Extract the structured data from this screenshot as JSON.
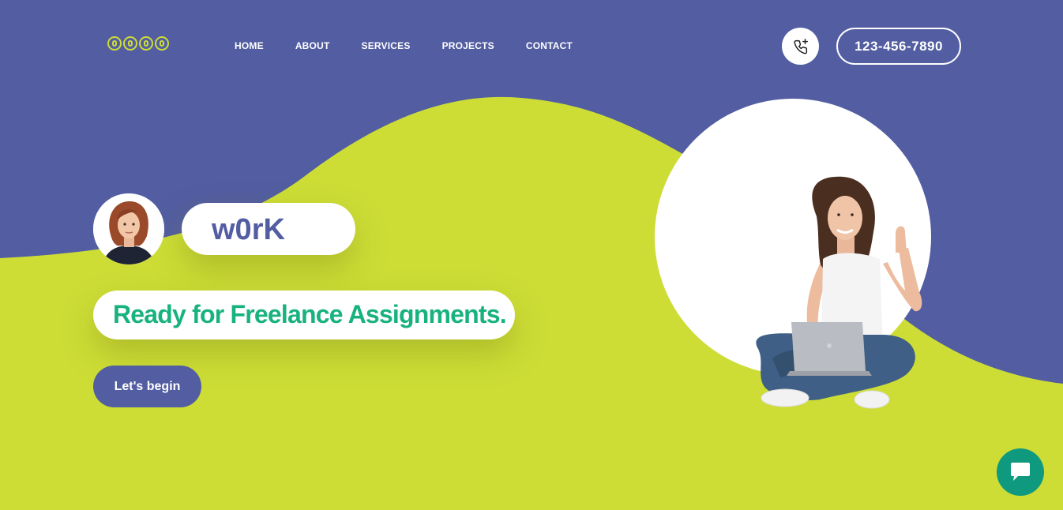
{
  "brand": {
    "logo_icon": "logo-icon",
    "accent": "#cddd36",
    "primary": "#525da2",
    "green": "#18b27f"
  },
  "nav": {
    "items": [
      "HOME",
      "ABOUT",
      "SERVICES",
      "PROJECTS",
      "CONTACT"
    ]
  },
  "header": {
    "phone_icon": "phone-plus-icon",
    "phone_number": "123-456-7890"
  },
  "hero": {
    "word": "w0rK",
    "headline": "Ready for Freelance Assignments.",
    "cta_label": "Let's begin",
    "avatar": "avatar",
    "image": "hero-woman-with-laptop"
  },
  "chat": {
    "icon": "chat-icon",
    "color": "#0f9a7f"
  }
}
